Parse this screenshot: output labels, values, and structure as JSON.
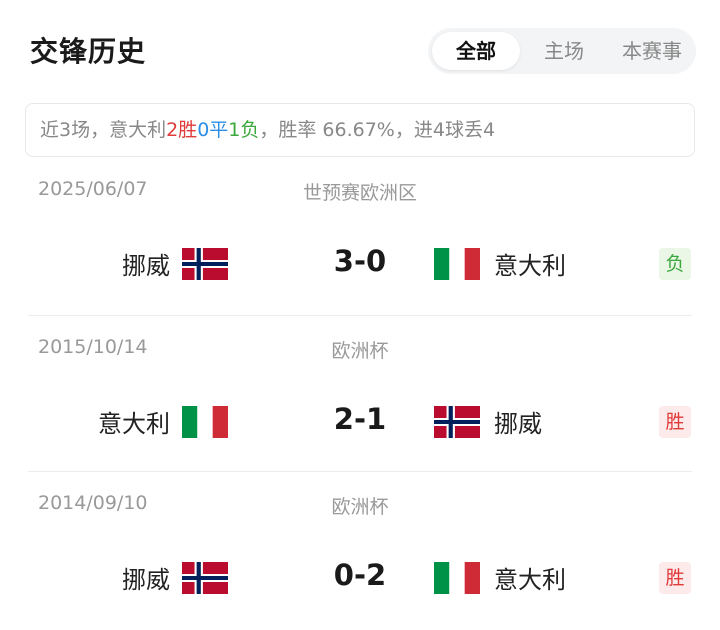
{
  "header": {
    "title": "交锋历史",
    "tabs": [
      {
        "label": "全部",
        "active": true
      },
      {
        "label": "主场",
        "active": false
      },
      {
        "label": "本赛事",
        "active": false
      }
    ]
  },
  "summary": {
    "prefix": "近3场，意大利",
    "wins": "2胜",
    "draws": "0平",
    "losses": "1负",
    "suffix": "，胜率 66.67%，进4球丢4"
  },
  "colors": {
    "win": "#e03a3a",
    "draw": "#2b8fe8",
    "loss": "#3aa83a"
  },
  "matches": [
    {
      "date": "2025/06/07",
      "competition": "世预赛欧洲区",
      "home": {
        "name": "挪威",
        "flag": "norway-flag-icon"
      },
      "score": "3-0",
      "away": {
        "name": "意大利",
        "flag": "italy-flag-icon"
      },
      "result": "负"
    },
    {
      "date": "2015/10/14",
      "competition": "欧洲杯",
      "home": {
        "name": "意大利",
        "flag": "italy-flag-icon"
      },
      "score": "2-1",
      "away": {
        "name": "挪威",
        "flag": "norway-flag-icon"
      },
      "result": "胜"
    },
    {
      "date": "2014/09/10",
      "competition": "欧洲杯",
      "home": {
        "name": "挪威",
        "flag": "norway-flag-icon"
      },
      "score": "0-2",
      "away": {
        "name": "意大利",
        "flag": "italy-flag-icon"
      },
      "result": "胜"
    }
  ]
}
